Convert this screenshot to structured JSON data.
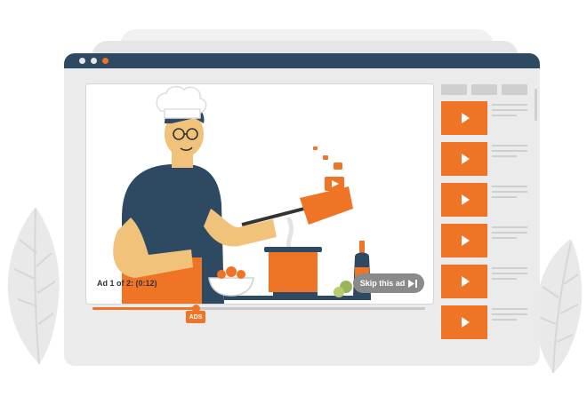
{
  "player": {
    "ad_status": "Ad 1 of 2: (0:12)",
    "skip_label": "Skip this ad",
    "progress_fraction": 0.31,
    "ads_badge": "ADS"
  },
  "playlist": {
    "tab_count": 3,
    "thumbnail_count": 6
  },
  "colors": {
    "accent": "#f07426",
    "titlebar": "#2e4a63",
    "dot_inactive": "#e6e6e6",
    "dot_active": "#f07426"
  },
  "icons": {
    "skip": "skip-next-icon",
    "thumbnail": "play-icon"
  }
}
